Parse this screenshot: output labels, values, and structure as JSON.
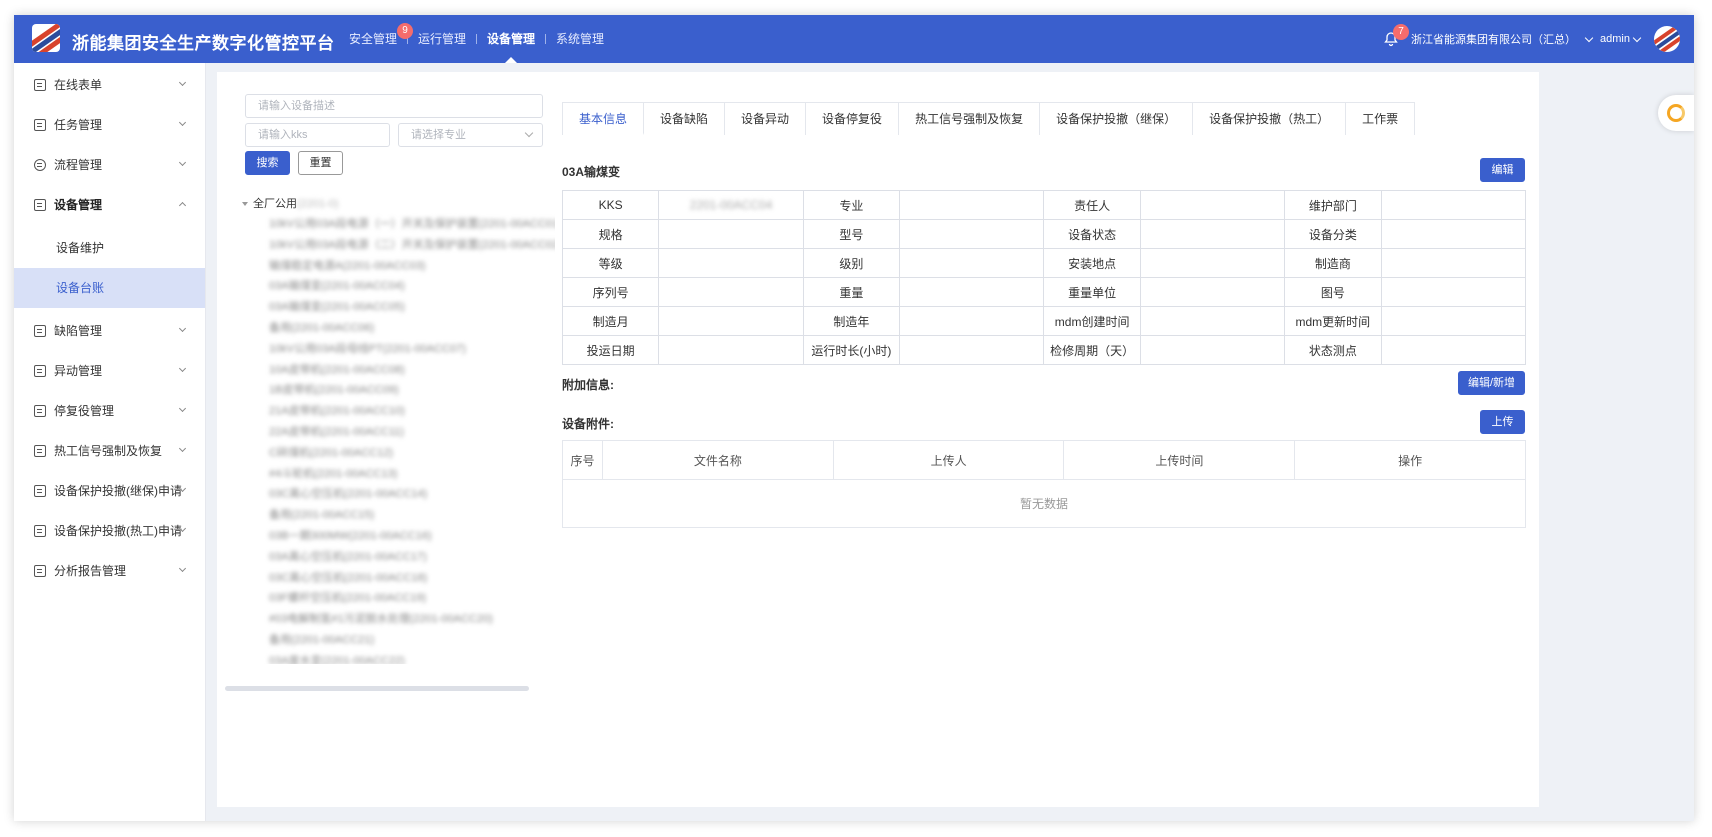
{
  "header": {
    "title": "浙能集团安全生产数字化管控平台",
    "nav": [
      {
        "label": "安全管理",
        "badge": "9",
        "active": false
      },
      {
        "label": "运行管理",
        "active": false
      },
      {
        "label": "设备管理",
        "active": true
      },
      {
        "label": "系统管理",
        "active": false
      }
    ],
    "notification_count": "7",
    "company": "浙江省能源集团有限公司（汇总）",
    "user": "admin"
  },
  "sidebar": {
    "items": [
      {
        "label": "在线表单",
        "icon": "form-icon"
      },
      {
        "label": "任务管理",
        "icon": "task-icon"
      },
      {
        "label": "流程管理",
        "icon": "process-icon"
      },
      {
        "label": "设备管理",
        "icon": "device-icon",
        "open": true,
        "children": [
          "设备维护",
          "设备台账"
        ],
        "active_child": "设备台账"
      },
      {
        "label": "缺陷管理",
        "icon": "defect-icon"
      },
      {
        "label": "异动管理",
        "icon": "change-icon"
      },
      {
        "label": "停复役管理",
        "icon": "outage-icon"
      },
      {
        "label": "热工信号强制及恢复",
        "icon": "signal-icon"
      },
      {
        "label": "设备保护投撤(继保)申请",
        "icon": "relay-protect-icon"
      },
      {
        "label": "设备保护投撤(热工)申请",
        "icon": "thermal-protect-icon"
      },
      {
        "label": "分析报告管理",
        "icon": "report-icon"
      }
    ]
  },
  "search": {
    "desc_placeholder": "请输入设备描述",
    "kks_placeholder": "请输入kks",
    "major_placeholder": "请选择专业",
    "search_label": "搜索",
    "reset_label": "重置"
  },
  "tree": {
    "root_label": "全厂公用",
    "root_code": "(2201-0)",
    "nodes": [
      "10kV公用03A段电源（一）开关及保护装置(2201-00ACC01)",
      "10kV公用03A段电源（二）开关及保护装置(2201-00ACC02)",
      "输煤稳定电源A(2201-00ACC03)",
      "03A输煤变(2201-00ACC04)",
      "03A输煤变(2201-00ACC05)",
      "备用(2201-00ACC06)",
      "10kV公用03A段母线PT(2201-00ACC07)",
      "10A皮带机(2201-00ACC08)",
      "1B皮带机(2201-00ACC09)",
      "21A皮带机(2201-00ACC10)",
      "22A皮带机(2201-00ACC11)",
      "C碎煤机(2201-00ACC12)",
      "#4斗轮机(2201-00ACC13)",
      "03C离心空压机(2201-00ACC14)",
      "备用(2201-00ACC15)",
      "03B一期300MW(2201-00ACC16)",
      "03A离心空压机(2201-00ACC17)",
      "03C离心空压机(2201-00ACC18)",
      "03F螺杆空压机(2201-00ACC19)",
      "#03电解制氢#1污泥脱水处理(2201-00ACC20)",
      "备用(2201-00ACC21)",
      "03A废水变(2201-00ACC22)"
    ]
  },
  "tabs": [
    "基本信息",
    "设备缺陷",
    "设备异动",
    "设备停复役",
    "热工信号强制及恢复",
    "设备保护投撤（继保）",
    "设备保护投撤（热工）",
    "工作票"
  ],
  "active_tab": "基本信息",
  "equipment": {
    "title": "03A输煤变",
    "edit_label": "编辑",
    "rows": [
      [
        {
          "label": "KKS",
          "value": "2201-00ACC04"
        },
        {
          "label": "专业",
          "value": ""
        },
        {
          "label": "责任人",
          "value": ""
        },
        {
          "label": "维护部门",
          "value": ""
        }
      ],
      [
        {
          "label": "规格",
          "value": ""
        },
        {
          "label": "型号",
          "value": ""
        },
        {
          "label": "设备状态",
          "value": ""
        },
        {
          "label": "设备分类",
          "value": ""
        }
      ],
      [
        {
          "label": "等级",
          "value": ""
        },
        {
          "label": "级别",
          "value": ""
        },
        {
          "label": "安装地点",
          "value": ""
        },
        {
          "label": "制造商",
          "value": ""
        }
      ],
      [
        {
          "label": "序列号",
          "value": ""
        },
        {
          "label": "重量",
          "value": ""
        },
        {
          "label": "重量单位",
          "value": ""
        },
        {
          "label": "图号",
          "value": ""
        }
      ],
      [
        {
          "label": "制造月",
          "value": ""
        },
        {
          "label": "制造年",
          "value": ""
        },
        {
          "label": "mdm创建时间",
          "value": ""
        },
        {
          "label": "mdm更新时间",
          "value": ""
        }
      ],
      [
        {
          "label": "投运日期",
          "value": ""
        },
        {
          "label": "运行时长(小时)",
          "value": ""
        },
        {
          "label": "检修周期（天）",
          "value": ""
        },
        {
          "label": "状态测点",
          "value": ""
        }
      ]
    ]
  },
  "extra": {
    "title": "附加信息:",
    "button": "编辑/新增"
  },
  "attachments": {
    "title": "设备附件:",
    "upload_label": "上传",
    "columns": [
      "序号",
      "文件名称",
      "上传人",
      "上传时间",
      "操作"
    ],
    "empty_text": "暂无数据"
  },
  "colors": {
    "primary": "#3a5fcd",
    "badge": "#f56c6c",
    "active_bg": "#d8e0f7"
  }
}
